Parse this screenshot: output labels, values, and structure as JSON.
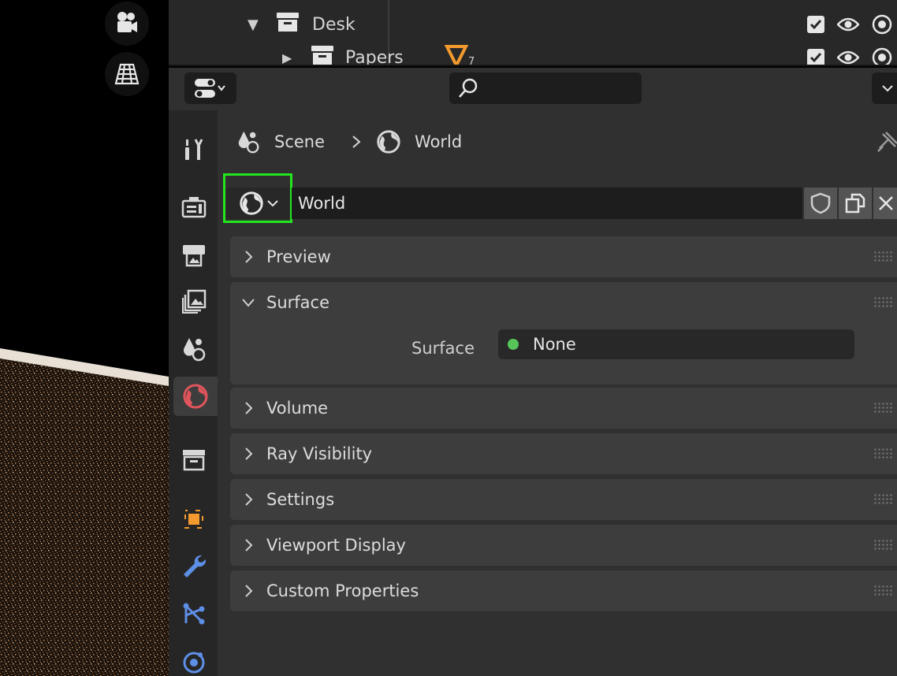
{
  "outliner": {
    "rows": [
      {
        "name": "Desk"
      },
      {
        "name": "Papers",
        "badge": "7"
      }
    ]
  },
  "properties": {
    "search_placeholder": "",
    "breadcrumb": {
      "scene": "Scene",
      "world": "World"
    },
    "datablock": {
      "name": "World"
    },
    "panels": {
      "preview": "Preview",
      "surface": "Surface",
      "volume": "Volume",
      "ray_visibility": "Ray Visibility",
      "settings": "Settings",
      "viewport_display": "Viewport Display",
      "custom_properties": "Custom Properties"
    },
    "surface_field": {
      "label": "Surface",
      "value": "None"
    }
  },
  "colors": {
    "highlight_box": "#22e61e",
    "world_tab_icon": "#e0555c",
    "surface_dot": "#57c45a",
    "object_tab": "#f39a2e",
    "modifier_tab": "#5e8fe6"
  }
}
